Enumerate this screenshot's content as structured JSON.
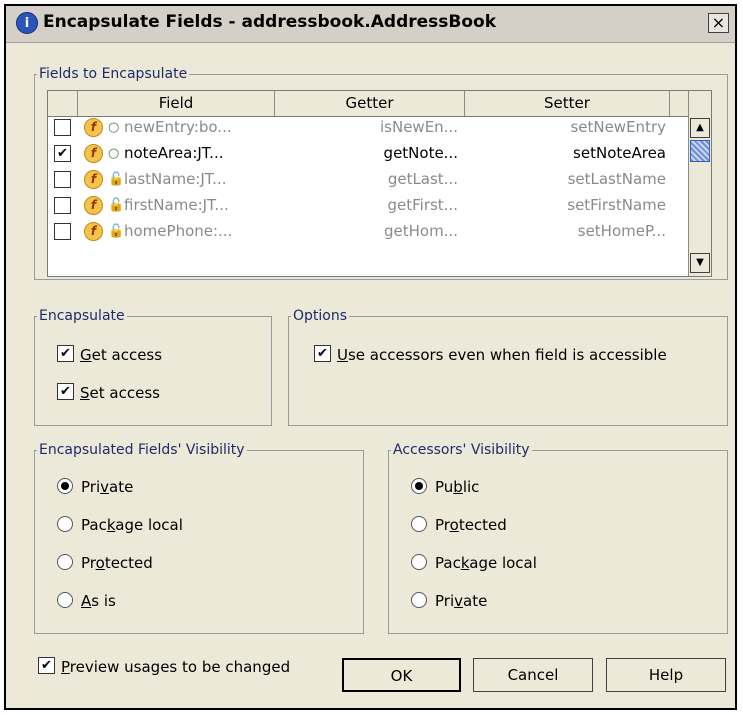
{
  "dialog": {
    "title": "Encapsulate Fields - addressbook.AddressBook",
    "close_symbol": "×",
    "title_icon": "idea-app-icon"
  },
  "fields_group": {
    "legend": "Fields to Encapsulate",
    "columns": [
      "Field",
      "Getter",
      "Setter"
    ],
    "rows": [
      {
        "checked": false,
        "field": "newEntry:bo...",
        "getter": "isNewEn...",
        "setter": "setNewEntry",
        "access_icon": "dot-icon",
        "enabled": false
      },
      {
        "checked": true,
        "field": "noteArea:JT...",
        "getter": "getNote...",
        "setter": "setNoteArea",
        "access_icon": "dot-icon",
        "enabled": true
      },
      {
        "checked": false,
        "field": "lastName:JT...",
        "getter": "getLast...",
        "setter": "setLastName",
        "access_icon": "lock-icon",
        "enabled": false
      },
      {
        "checked": false,
        "field": "firstName:JT...",
        "getter": "getFirst...",
        "setter": "setFirstName",
        "access_icon": "lock-icon",
        "enabled": false
      },
      {
        "checked": false,
        "field": "homePhone:...",
        "getter": "getHom...",
        "setter": "setHomeP...",
        "access_icon": "lock-icon",
        "enabled": false
      }
    ]
  },
  "encapsulate_group": {
    "legend": "Encapsulate",
    "get_access": {
      "pre": "",
      "mnemonic": "G",
      "post": "et access",
      "checked": true
    },
    "set_access": {
      "pre": "",
      "mnemonic": "S",
      "post": "et access",
      "checked": true
    }
  },
  "options_group": {
    "legend": "Options",
    "use_accessors": {
      "pre": "",
      "mnemonic": "U",
      "post": "se accessors even when field is accessible",
      "checked": true
    }
  },
  "field_visibility": {
    "legend": "Encapsulated Fields' Visibility",
    "options": [
      {
        "pre": "Pri",
        "mnemonic": "v",
        "post": "ate",
        "selected": true
      },
      {
        "pre": "Pac",
        "mnemonic": "k",
        "post": "age local",
        "selected": false
      },
      {
        "pre": "Pr",
        "mnemonic": "o",
        "post": "tected",
        "selected": false
      },
      {
        "pre": "",
        "mnemonic": "A",
        "post": "s is",
        "selected": false
      }
    ]
  },
  "accessor_visibility": {
    "legend": "Accessors' Visibility",
    "options": [
      {
        "pre": "Pu",
        "mnemonic": "b",
        "post": "lic",
        "selected": true
      },
      {
        "pre": "Pr",
        "mnemonic": "o",
        "post": "tected",
        "selected": false
      },
      {
        "pre": "Pac",
        "mnemonic": "k",
        "post": "age local",
        "selected": false
      },
      {
        "pre": "Pri",
        "mnemonic": "v",
        "post": "ate",
        "selected": false
      }
    ]
  },
  "footer": {
    "preview": {
      "pre": "",
      "mnemonic": "P",
      "post": "review usages to be changed",
      "checked": true
    },
    "ok_label": "OK",
    "cancel_label": "Cancel",
    "help_label": "Help"
  },
  "glyphs": {
    "check": "✔",
    "up": "▲",
    "down": "▼",
    "field_icon": "f",
    "dot": "○",
    "lock": "🔓"
  }
}
